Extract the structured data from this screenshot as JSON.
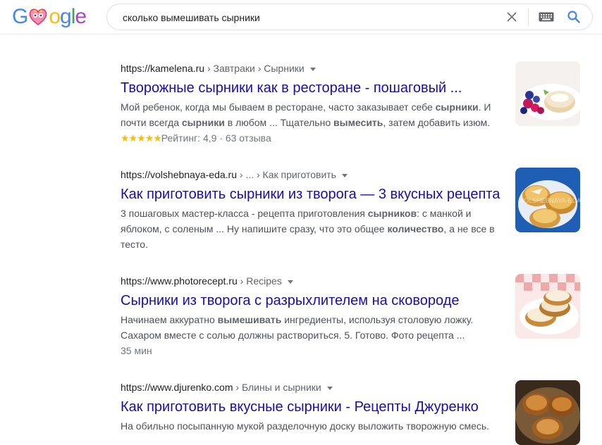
{
  "header": {
    "logo_letters": [
      "G",
      "o",
      "o",
      "g",
      "l",
      "e"
    ],
    "search": {
      "query": "сколько вымешивать сырники"
    },
    "icons": {
      "clear": "close-icon",
      "keyboard": "keyboard-icon",
      "search": "search-icon"
    }
  },
  "colors": {
    "link": "#1a0dab",
    "snippet": "#4d5156",
    "stars": "#fbbc04",
    "accent": "#4285f4"
  },
  "results": [
    {
      "url": "https://kamelena.ru",
      "breadcrumb": " › Завтраки › Сырники",
      "title": "Творожные сырники как в ресторане - пошаговый ...",
      "snippet": [
        {
          "t": "Мой ребенок, когда мы бываем в ресторане, часто заказывает себе "
        },
        {
          "t": "сырники",
          "b": true
        },
        {
          "t": ". И почти всегда "
        },
        {
          "t": "сырники",
          "b": true
        },
        {
          "t": " в любом ... Тщательно "
        },
        {
          "t": "вымесить",
          "b": true
        },
        {
          "t": ", затем добавить изюм."
        }
      ],
      "rating": {
        "stars": "★★★★★",
        "label": "Рейтинг: 4,9 · 63 отзыва",
        "value": 4.9,
        "count": 63
      },
      "thumb": "berries-syrniki"
    },
    {
      "url": "https://volshebnaya-eda.ru",
      "breadcrumb": " › ... › Как приготовить",
      "title": "Как приготовить сырники из творога — 3 вкусных рецепта",
      "snippet": [
        {
          "t": "3 пошаговых мастер-класса - рецепта приготовления "
        },
        {
          "t": "сырников",
          "b": true
        },
        {
          "t": ": с манкой и яблоком, с соленым ... Ну напишите сразу, что это общее "
        },
        {
          "t": "количество",
          "b": true
        },
        {
          "t": ", а не все в тесто."
        }
      ],
      "thumb_text": "VOLSHEBNAYA-EDA",
      "thumb": "syrniki-plate"
    },
    {
      "url": "https://www.photorecept.ru",
      "breadcrumb": " › Recipes",
      "title": "Сырники из творога с разрыхлителем на сковороде",
      "snippet": [
        {
          "t": "Начинаем аккуратно "
        },
        {
          "t": "вымешивать",
          "b": true
        },
        {
          "t": " ингредиенты, используя столовую ложку. Сахаром вместе с солью должны раствориться. 5. Готово. Фото рецепта ..."
        }
      ],
      "meta": "35 мин",
      "thumb": "syrniki-stack"
    },
    {
      "url": "https://www.djurenko.com",
      "breadcrumb": " › Блины и сырники",
      "title": "Как приготовить вкусные сырники - Рецепты Джуренко",
      "snippet": [
        {
          "t": "На обильно посыпанную мукой разделочную доску выложить творожную смесь."
        }
      ],
      "thumb": "syrniki-pan"
    }
  ]
}
